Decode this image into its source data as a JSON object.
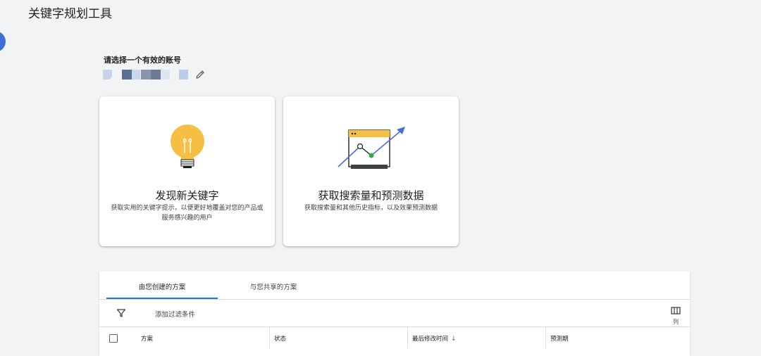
{
  "header": {
    "title": "关键字规划工具"
  },
  "account": {
    "label": "请选择一个有效的账号"
  },
  "cards": [
    {
      "title": "发现新关键字",
      "description": "获取实用的关键字提示，以便更好地覆盖对您的产品或服务感兴趣的用户"
    },
    {
      "title": "获取搜索量和预测数据",
      "description": "获取搜索量和其他历史指标，以及效果预测数据"
    }
  ],
  "plans": {
    "tabs": [
      {
        "label": "由您创建的方案",
        "active": true
      },
      {
        "label": "与您共享的方案",
        "active": false
      }
    ],
    "filter_label": "添加过滤条件",
    "columns_label": "列",
    "table": {
      "columns": [
        "方案",
        "状态",
        "最后修改时间",
        "预测期"
      ],
      "sort_indicator": "↓"
    }
  },
  "colors": {
    "accent": "#1a73e8",
    "bulb": "#f4bf42",
    "background": "#f1f3f4"
  }
}
